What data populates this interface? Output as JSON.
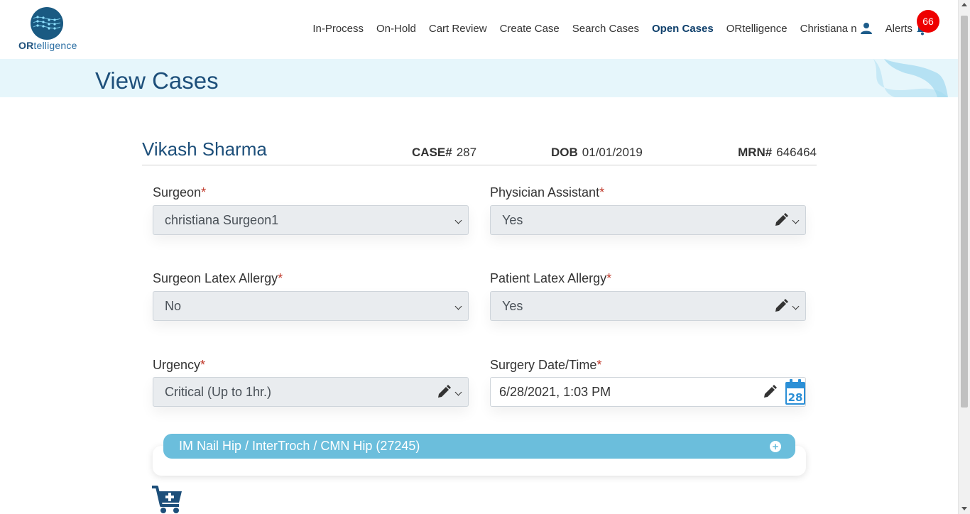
{
  "logo": {
    "brand_bold": "OR",
    "brand_rest": "telligence"
  },
  "nav": {
    "items": [
      "In-Process",
      "On-Hold",
      "Cart Review",
      "Create Case",
      "Search Cases",
      "Open Cases",
      "ORtelligence"
    ],
    "active": "Open Cases",
    "user_label": "Christiana n",
    "alerts_label": "Alerts",
    "alerts_count": "66"
  },
  "banner": {
    "title": "View Cases"
  },
  "patient": {
    "name": "Vikash Sharma",
    "case_label": "CASE#",
    "case_value": "287",
    "dob_label": "DOB",
    "dob_value": "01/01/2019",
    "mrn_label": "MRN#",
    "mrn_value": "646464"
  },
  "form": {
    "surgeon": {
      "label": "Surgeon",
      "value": "christiana Surgeon1"
    },
    "physician_assistant": {
      "label": "Physician Assistant",
      "value": "Yes"
    },
    "surgeon_latex": {
      "label": "Surgeon Latex Allergy",
      "value": "No"
    },
    "patient_latex": {
      "label": "Patient Latex Allergy",
      "value": "Yes"
    },
    "urgency": {
      "label": "Urgency",
      "value": "Critical (Up to 1hr.)"
    },
    "surgery_datetime": {
      "label": "Surgery Date/Time",
      "value": "6/28/2021, 1:03 PM",
      "calendar_day": "28"
    },
    "required_mark": "*"
  },
  "procedure": {
    "title": "IM Nail Hip / InterTroch / CMN Hip (27245)",
    "expand_symbol": "+"
  },
  "colors": {
    "primary": "#1d4f7a",
    "accent": "#6bbedc",
    "badge": "#ee0000",
    "banner": "#e6f6fb"
  },
  "icons": [
    "logo-globe-icon",
    "user-icon",
    "bell-icon",
    "pencil-icon",
    "chevron-down-icon",
    "calendar-icon",
    "plus-circle-icon",
    "cart-plus-icon"
  ]
}
